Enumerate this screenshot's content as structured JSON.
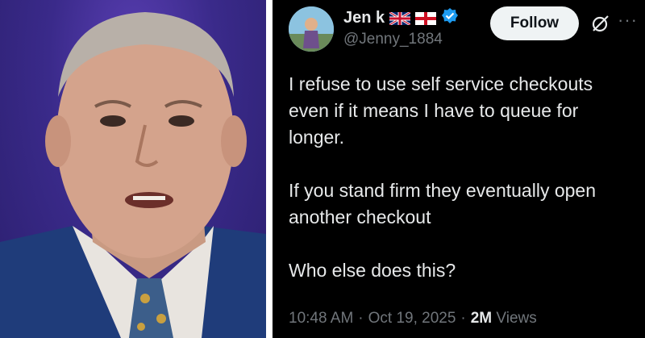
{
  "tweet": {
    "display_name": "Jen k",
    "handle": "@Jenny_1884",
    "follow_label": "Follow",
    "more_label": "···",
    "body": "I refuse to use self service checkouts even if it means I have to queue for longer.\n\nIf you stand firm they eventually open another checkout\n\nWho else does this?",
    "time": "10:48 AM",
    "separator": "·",
    "date": "Oct 19, 2025",
    "views_count": "2M",
    "views_label": "Views"
  },
  "icons": {
    "flag_1": "uk-flag-icon",
    "flag_2": "england-flag-icon",
    "verified": "verified-badge-icon",
    "grok": "grok-icon"
  },
  "colors": {
    "background": "#000000",
    "text": "#e7e9ea",
    "muted": "#71767b",
    "verified": "#1d9bf0",
    "follow_bg": "#eff3f4"
  }
}
